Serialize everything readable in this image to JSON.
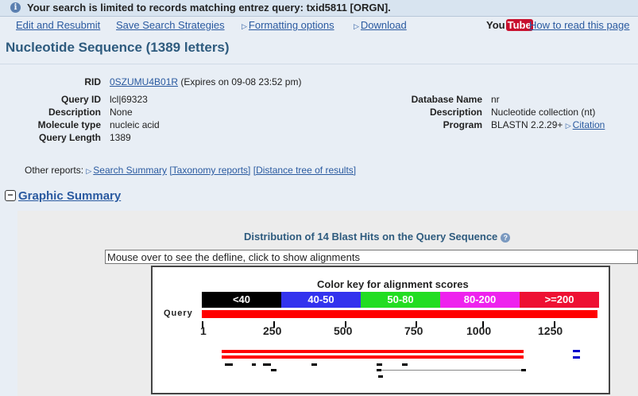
{
  "notice": {
    "icon": "info-icon",
    "text": "Your search is limited to records matching entrez query: txid5811 [ORGN]."
  },
  "toolbar": {
    "edit_resubmit": "Edit and Resubmit",
    "save_strategies": "Save Search Strategies",
    "formatting_options": "Formatting options",
    "download": "Download",
    "youtube_you": "You",
    "youtube_tube": "Tube",
    "how_to_read": "How to read this page"
  },
  "title": "Nucleotide Sequence (1389 letters)",
  "rid": {
    "label": "RID",
    "value": "0SZUMU4B01R",
    "expires": "(Expires on 09-08 23:52 pm)"
  },
  "query": [
    {
      "label": "Query ID",
      "value": "lcl|69323"
    },
    {
      "label": "Description",
      "value": "None"
    },
    {
      "label": "Molecule type",
      "value": "nucleic acid"
    },
    {
      "label": "Query Length",
      "value": "1389"
    }
  ],
  "database": [
    {
      "label": "Database Name",
      "value": "nr"
    },
    {
      "label": "Description",
      "value": "Nucleotide collection (nt)"
    },
    {
      "label": "Program",
      "value": "BLASTN 2.2.29+",
      "link": "Citation"
    }
  ],
  "other_reports": {
    "label": "Other reports:",
    "search_summary": "Search Summary",
    "taxonomy": "[Taxonomy reports]",
    "distance_tree": "[Distance tree of results]"
  },
  "graphic_summary": {
    "heading": "Graphic Summary",
    "toggle": "−",
    "distribution": "Distribution of 14 Blast Hits on the Query Sequence",
    "defline_hint": "Mouse over to see the defline, click to show alignments",
    "color_key_title": "Color key for alignment scores",
    "color_key": [
      {
        "label": "<40",
        "color": "#000000"
      },
      {
        "label": "40-50",
        "color": "#3333ee"
      },
      {
        "label": "50-80",
        "color": "#22dd22"
      },
      {
        "label": "80-200",
        "color": "#ee22ee"
      },
      {
        "label": ">=200",
        "color": "#ee1133"
      }
    ],
    "query_label": "Query",
    "ticks": [
      "1",
      "250",
      "500",
      "750",
      "1000",
      "1250"
    ]
  }
}
